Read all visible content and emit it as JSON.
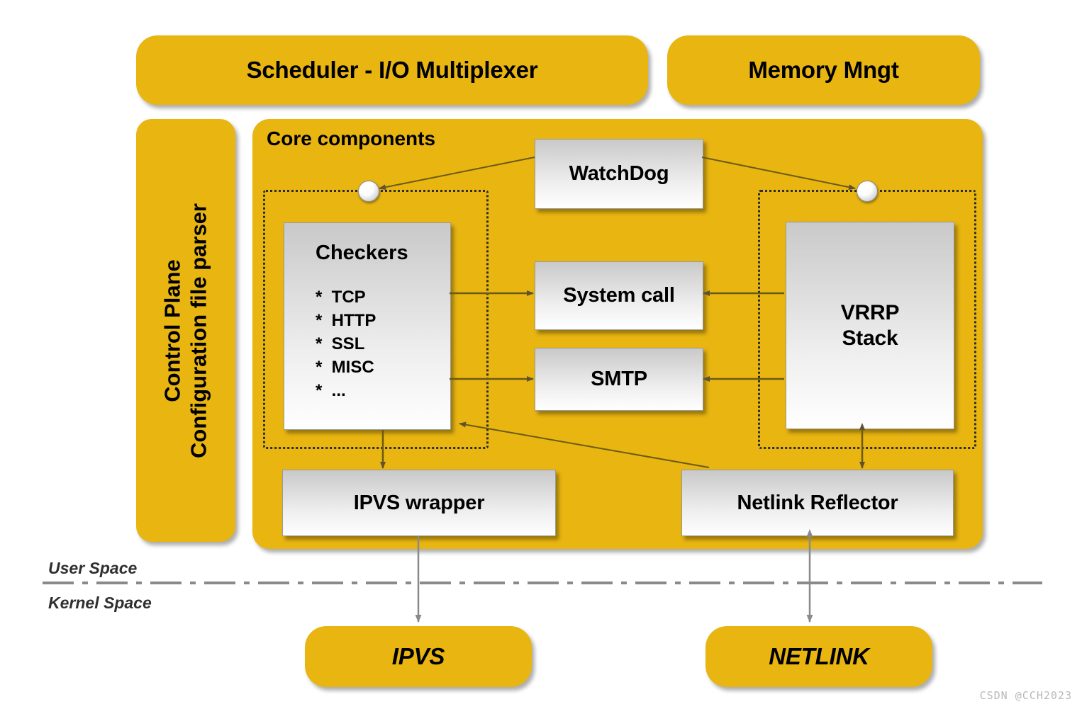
{
  "colors": {
    "accent_yellow": "#E8B511",
    "box_grey_top": "#c9c9c9",
    "box_white_bottom": "#ffffff",
    "line": "#6b5a12",
    "text": "#000000",
    "watermark": "#b9b9b9"
  },
  "top_bar": {
    "scheduler_label": "Scheduler - I/O Multiplexer",
    "memory_label": "Memory Mngt"
  },
  "sidebar": {
    "line1": "Control Plane",
    "line2": "Configuration file parser"
  },
  "core": {
    "title": "Core components",
    "checkers": {
      "title": "Checkers",
      "items": [
        "*  TCP",
        "*  HTTP",
        "*  SSL",
        "*  MISC",
        "*  ..."
      ]
    },
    "watchdog_label": "WatchDog",
    "system_call_label": "System call",
    "smtp_label": "SMTP",
    "vrrp_label": "VRRP\nStack",
    "vrrp_line1": "VRRP",
    "vrrp_line2": "Stack",
    "ipvs_wrapper_label": "IPVS wrapper",
    "netlink_reflector_label": "Netlink Reflector"
  },
  "space_divider": {
    "user_space_label": "User Space",
    "kernel_space_label": "Kernel Space"
  },
  "kernel": {
    "ipvs_label": "IPVS",
    "netlink_label": "NETLINK"
  },
  "watermark": {
    "text": "CSDN @CCH2023"
  },
  "icons": {
    "connector_left": "connector-dot-icon",
    "connector_right": "connector-dot-icon"
  }
}
